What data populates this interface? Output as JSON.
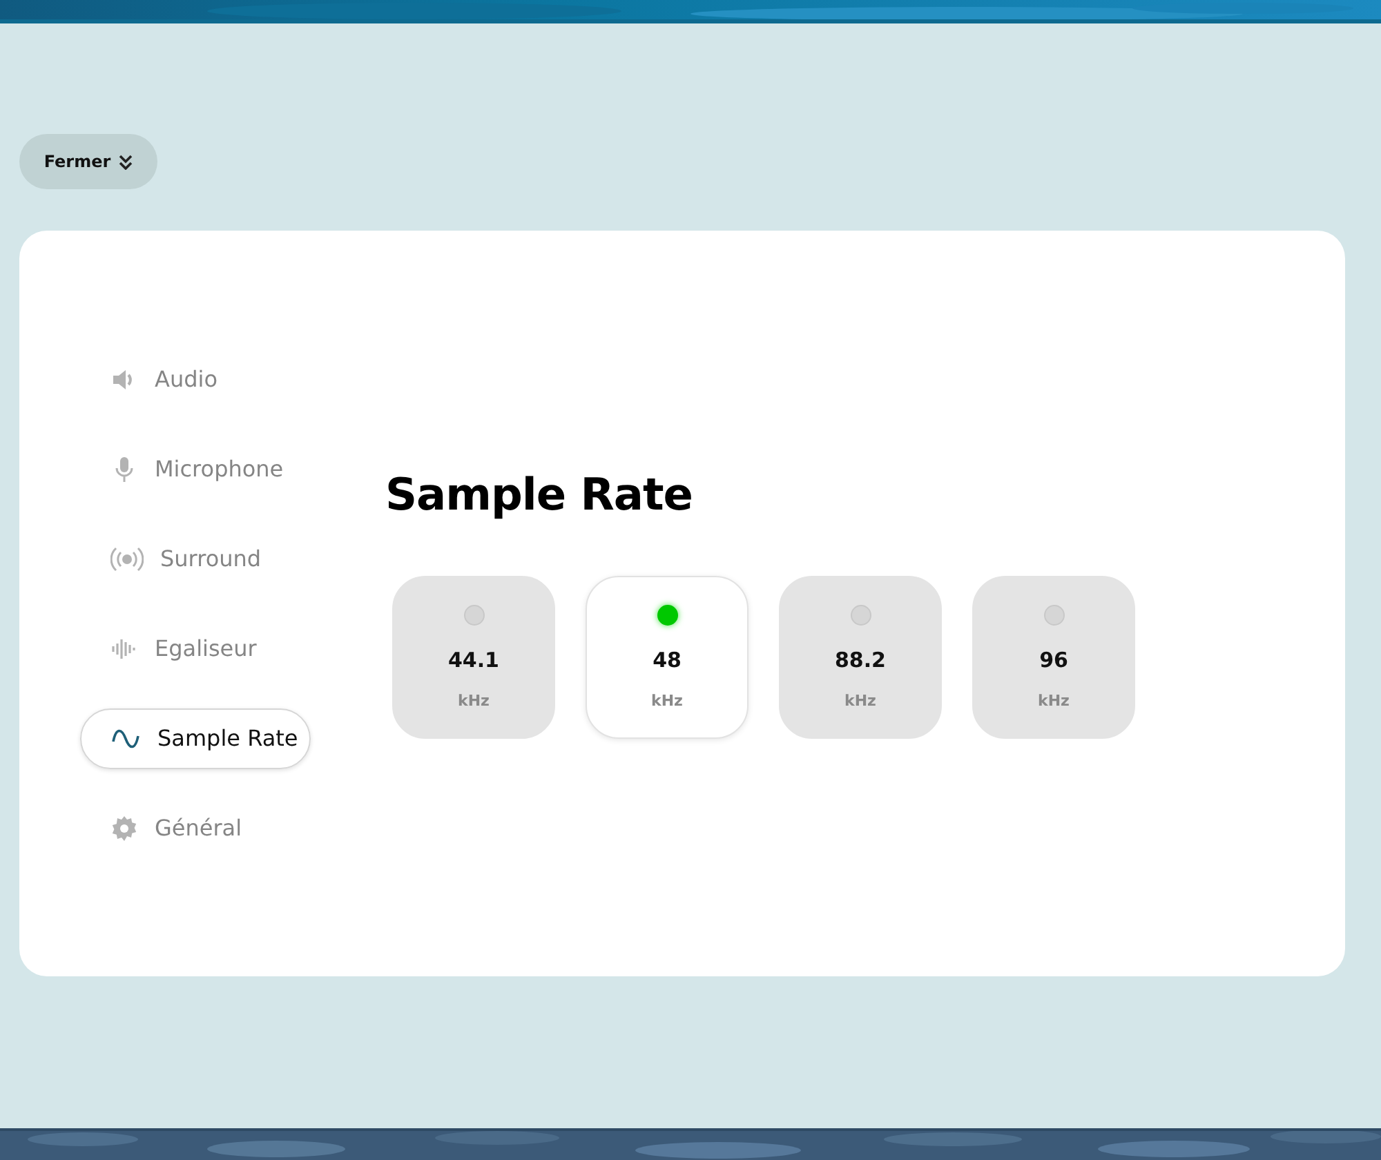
{
  "close_button": {
    "label": "Fermer"
  },
  "sidebar": {
    "items": [
      {
        "label": "Audio",
        "selected": false
      },
      {
        "label": "Microphone",
        "selected": false
      },
      {
        "label": "Surround",
        "selected": false
      },
      {
        "label": "Egaliseur",
        "selected": false
      },
      {
        "label": "Sample Rate",
        "selected": true
      },
      {
        "label": "Général",
        "selected": false
      }
    ]
  },
  "heading": "Sample Rate",
  "rates": [
    {
      "value": "44.1",
      "unit": "kHz",
      "selected": false
    },
    {
      "value": "48",
      "unit": "kHz",
      "selected": true
    },
    {
      "value": "88.2",
      "unit": "kHz",
      "selected": false
    },
    {
      "value": "96",
      "unit": "kHz",
      "selected": false
    }
  ]
}
